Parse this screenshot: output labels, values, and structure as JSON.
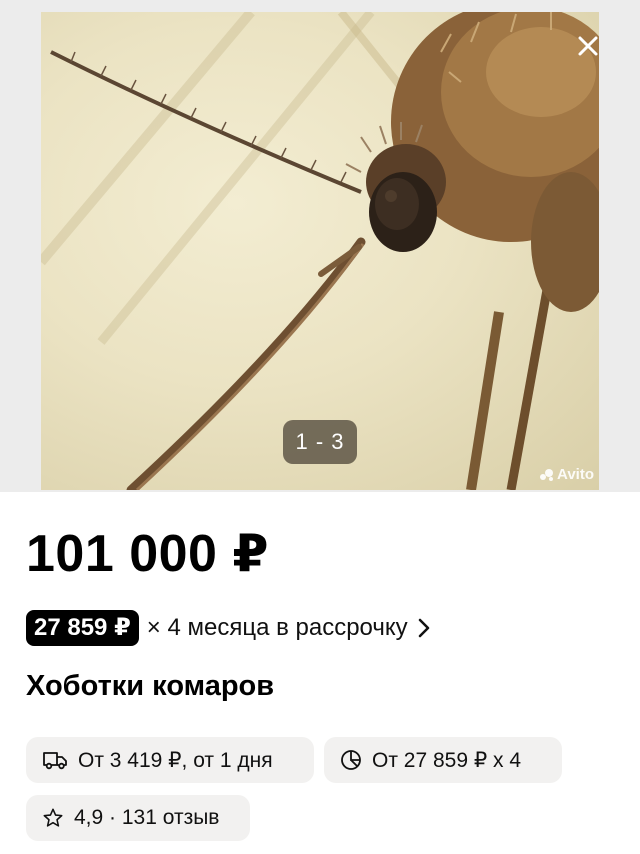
{
  "gallery": {
    "counter": "1 - 3",
    "watermark": "Avito",
    "close_icon": "close-icon"
  },
  "listing": {
    "price": "101 000 ₽",
    "installment_amount": "27 859 ₽",
    "installment_text": "× 4 месяца в рассрочку",
    "title": "Хоботки комаров"
  },
  "chips": {
    "delivery": {
      "icon": "truck-icon",
      "label": "От 3 419 ₽, от 1 дня"
    },
    "installment": {
      "icon": "pie-chart-icon",
      "label": "От 27 859 ₽ х 4"
    },
    "rating": {
      "icon": "star-outline-icon",
      "label": "4,9 · 131 отзыв"
    }
  },
  "colors": {
    "chip_bg": "#f2f1f0",
    "badge_bg": "#000000",
    "gallery_bg": "#ececec"
  }
}
